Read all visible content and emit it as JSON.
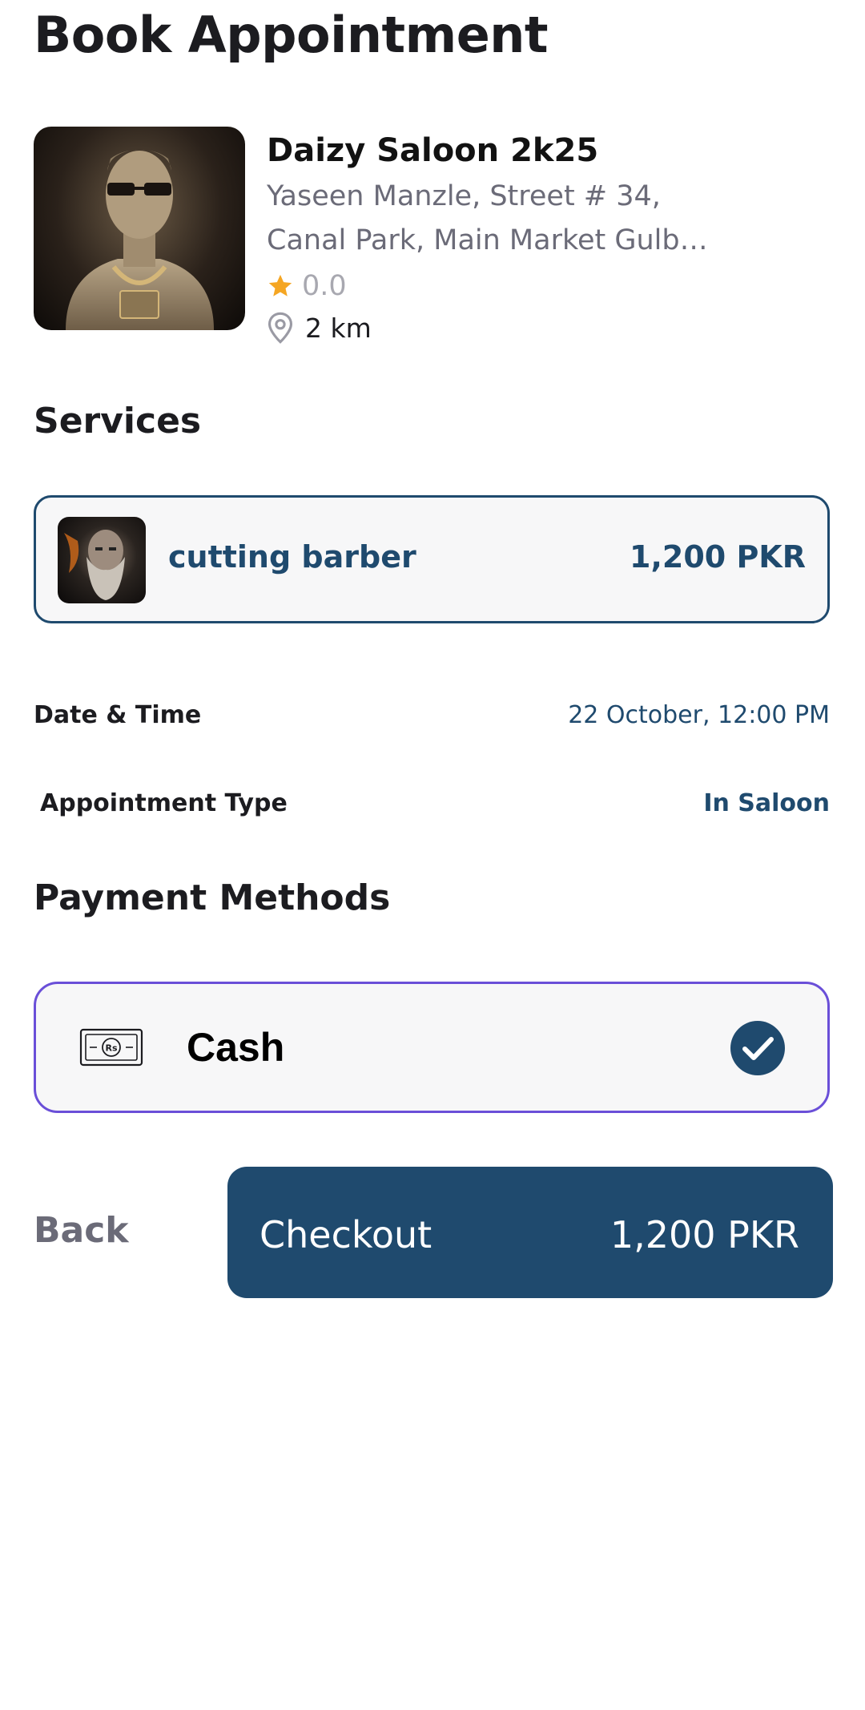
{
  "header": {
    "title": "Book Appointment"
  },
  "salon": {
    "name": "Daizy Saloon 2k25",
    "address_line1": "Yaseen Manzle, Street # 34,",
    "address_line2": "Canal Park, Main Market Gulb…",
    "rating": "0.0",
    "distance": "2  km",
    "photo_icon": "salon-photo",
    "rating_icon": "star-icon",
    "distance_icon": "location-pin-icon"
  },
  "services": {
    "title": "Services",
    "items": [
      {
        "name": "cutting barber",
        "price": "1,200 PKR"
      }
    ]
  },
  "appointment": {
    "date_time_label": "Date & Time",
    "date_time_value": "22 October, 12:00 PM",
    "type_label": "Appointment Type",
    "type_value": "In Saloon"
  },
  "payment": {
    "title": "Payment Methods",
    "methods": [
      {
        "label": "Cash",
        "icon": "cash-icon",
        "selected": true
      }
    ]
  },
  "footer": {
    "back_label": "Back",
    "checkout_label": "Checkout",
    "checkout_total": "1,200 PKR"
  },
  "colors": {
    "primary": "#1f4a6e",
    "accent_border": "#6a4fd8",
    "star": "#f5a623",
    "muted_text": "#6b6b78"
  }
}
